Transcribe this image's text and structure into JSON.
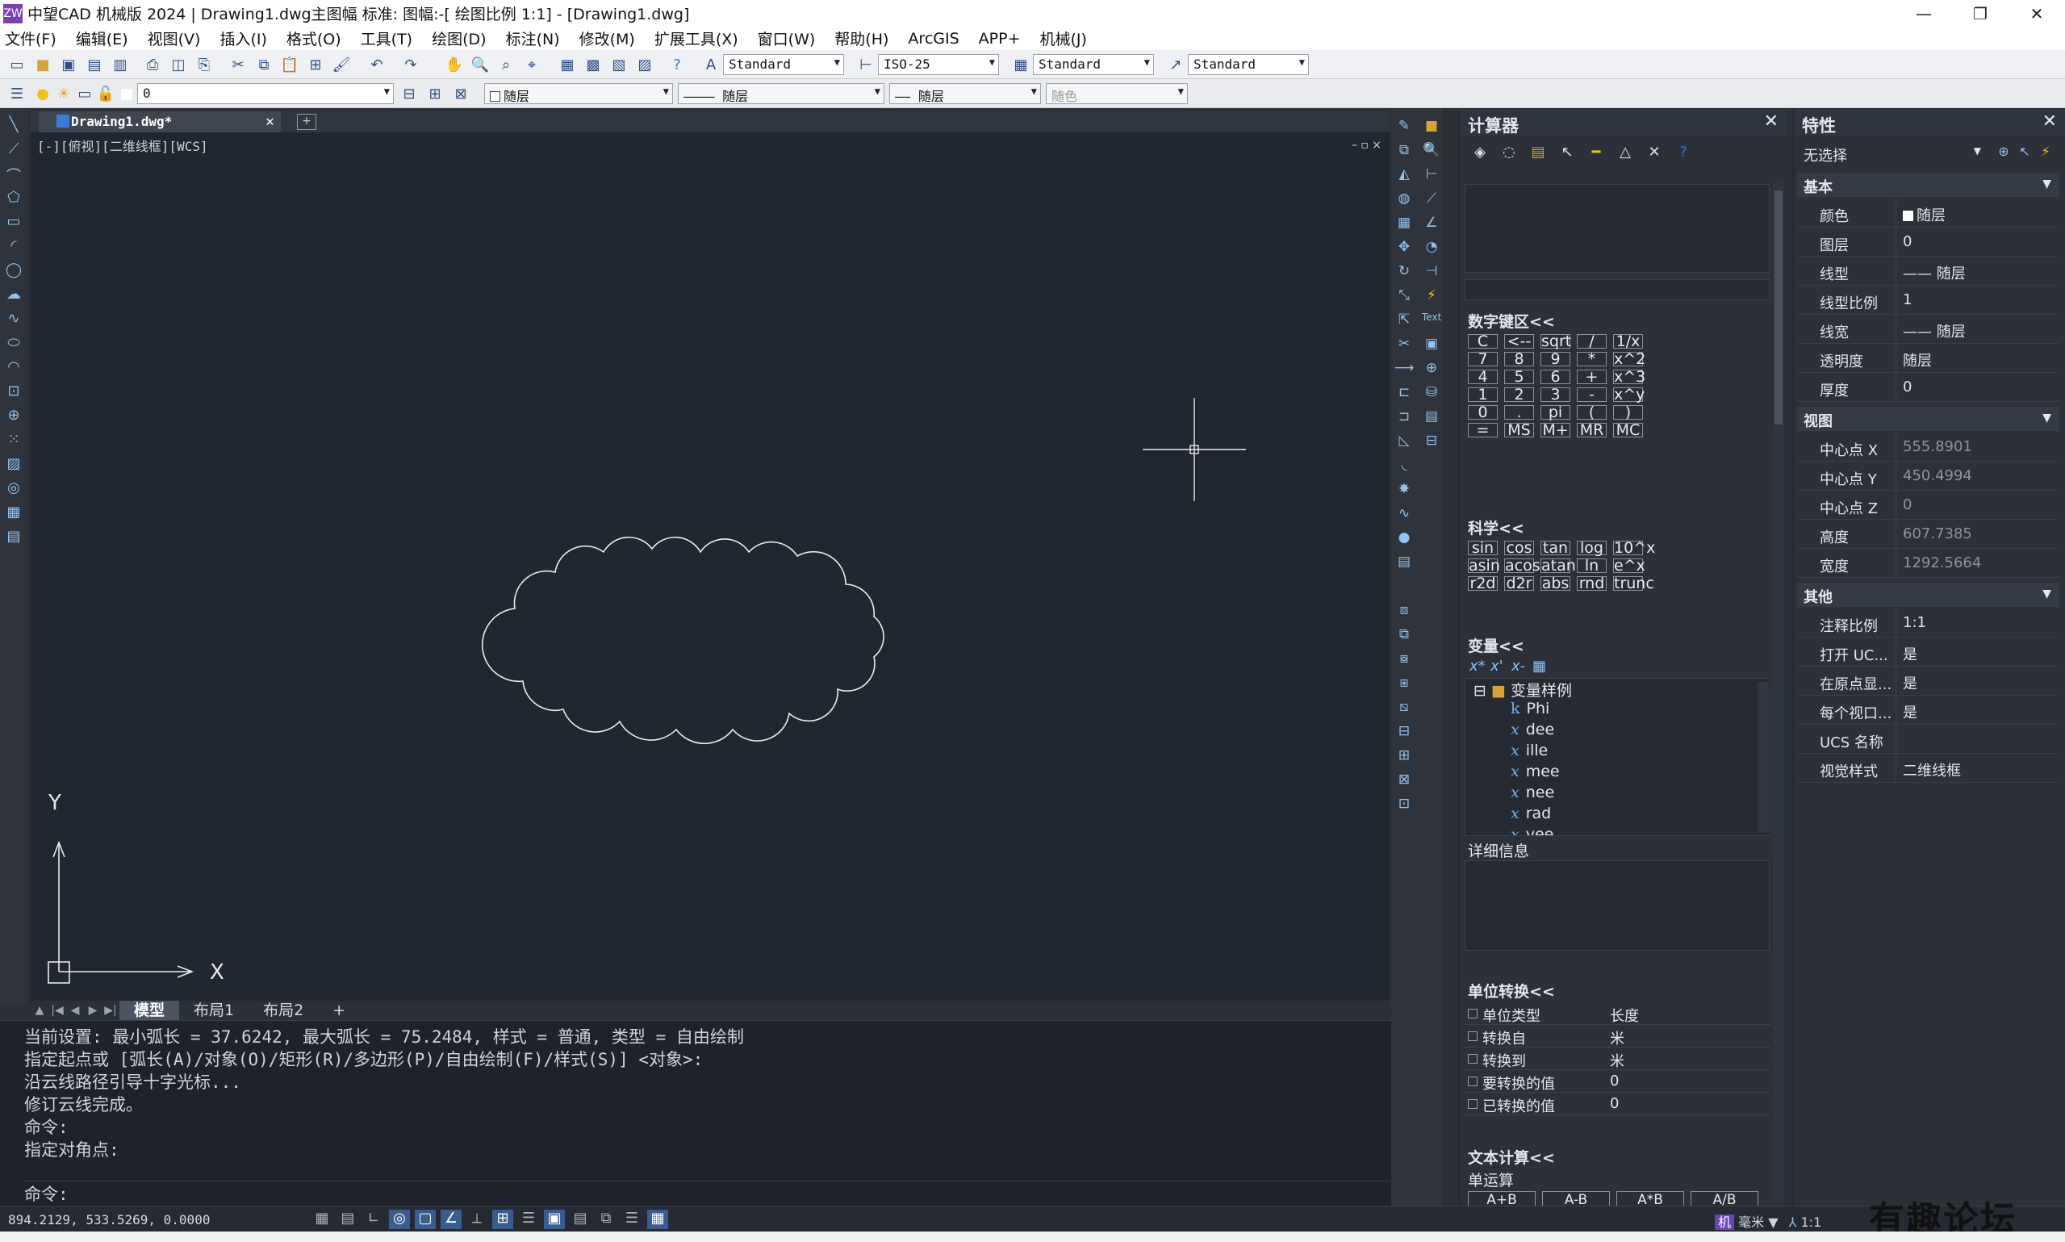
{
  "window": {
    "title": "中望CAD 机械版 2024 | Drawing1.dwg主图幅  标准: 图幅:-[ 绘图比例 1:1] - [Drawing1.dwg]",
    "app_icon": "ZW"
  },
  "menu": [
    "文件(F)",
    "编辑(E)",
    "视图(V)",
    "插入(I)",
    "格式(O)",
    "工具(T)",
    "绘图(D)",
    "标注(N)",
    "修改(M)",
    "扩展工具(X)",
    "窗口(W)",
    "帮助(H)",
    "ArcGIS",
    "APP+",
    "机械(J)"
  ],
  "toolbar": {
    "text_style": "Standard",
    "dim_style": "ISO-25",
    "table_style": "Standard",
    "mleader_style": "Standard",
    "layer": "0",
    "color": "随层",
    "linetype": "———— 随层",
    "lineweight": "—— 随层",
    "plot_style": "随色"
  },
  "doc_tab": {
    "name": "Drawing1.dwg*",
    "new_tab": "+"
  },
  "viewport": {
    "label": "[-][俯视][二维线框][WCS]",
    "controls": "– ▫ ×"
  },
  "ucs": {
    "x": "X",
    "y": "Y"
  },
  "layout_tabs": [
    "模型",
    "布局1",
    "布局2",
    "+"
  ],
  "command": {
    "history": [
      "当前设置: 最小弧长 = 37.6242, 最大弧长 = 75.2484, 样式 = 普通, 类型 = 自由绘制",
      "指定起点或 [弧长(A)/对象(O)/矩形(R)/多边形(P)/自由绘制(F)/样式(S)] <对象>:",
      "沿云线路径引导十字光标...",
      "修订云线完成。",
      "命令:",
      "指定对角点:"
    ],
    "prompt": "命令:"
  },
  "status": {
    "coords": "894.2129, 533.5269, 0.0000",
    "units": "毫米",
    "scale": "1:1",
    "watermark": "有趣论坛"
  },
  "calculator": {
    "title": "计算器",
    "numpad_label": "数字键区<<",
    "numpad_keys": [
      [
        "C",
        "<--",
        "sqrt",
        "/",
        "1/x"
      ],
      [
        "7",
        "8",
        "9",
        "*",
        "x^2"
      ],
      [
        "4",
        "5",
        "6",
        "+",
        "x^3"
      ],
      [
        "1",
        "2",
        "3",
        "-",
        "x^y"
      ],
      [
        "0",
        ".",
        "pi",
        "(",
        ")"
      ],
      [
        "=",
        "MS",
        "M+",
        "MR",
        "MC"
      ]
    ],
    "science_label": "科学<<",
    "science_keys": [
      [
        "sin",
        "cos",
        "tan",
        "log",
        "10^x"
      ],
      [
        "asin",
        "acos",
        "atan",
        "ln",
        "e^x"
      ],
      [
        "r2d",
        "d2r",
        "abs",
        "rnd",
        "trunc"
      ]
    ],
    "variables_label": "变量<<",
    "variable_folder": "变量样例",
    "variables": [
      {
        "type": "k",
        "name": "Phi"
      },
      {
        "type": "x",
        "name": "dee"
      },
      {
        "type": "x",
        "name": "ille"
      },
      {
        "type": "x",
        "name": "mee"
      },
      {
        "type": "x",
        "name": "nee"
      },
      {
        "type": "x",
        "name": "rad"
      },
      {
        "type": "x",
        "name": "vee"
      }
    ],
    "details_label": "详细信息",
    "unit_label": "单位转换<<",
    "unit_rows": [
      {
        "key": "单位类型",
        "value": "长度"
      },
      {
        "key": "转换自",
        "value": "米"
      },
      {
        "key": "转换到",
        "value": "米"
      },
      {
        "key": "要转换的值",
        "value": "0"
      },
      {
        "key": "已转换的值",
        "value": "0"
      }
    ],
    "text_calc_label": "文本计算<<",
    "unary_label": "单运算",
    "unary_ops": [
      "A+B",
      "A-B",
      "A*B",
      "A/B"
    ]
  },
  "properties": {
    "title": "特性",
    "selection": "无选择",
    "groups": [
      {
        "name": "基本",
        "rows": [
          {
            "key": "颜色",
            "value": "随层",
            "swatch": true
          },
          {
            "key": "图层",
            "value": "0"
          },
          {
            "key": "线型",
            "value": "—— 随层"
          },
          {
            "key": "线型比例",
            "value": "1"
          },
          {
            "key": "线宽",
            "value": "—— 随层"
          },
          {
            "key": "透明度",
            "value": "随层"
          },
          {
            "key": "厚度",
            "value": "0"
          }
        ]
      },
      {
        "name": "视图",
        "rows": [
          {
            "key": "中心点 X",
            "value": "555.8901",
            "grey": true
          },
          {
            "key": "中心点 Y",
            "value": "450.4994",
            "grey": true
          },
          {
            "key": "中心点 Z",
            "value": "0",
            "grey": true
          },
          {
            "key": "高度",
            "value": "607.7385",
            "grey": true
          },
          {
            "key": "宽度",
            "value": "1292.5664",
            "grey": true
          }
        ]
      },
      {
        "name": "其他",
        "rows": [
          {
            "key": "注释比例",
            "value": "1:1"
          },
          {
            "key": "打开 UC...",
            "value": "是"
          },
          {
            "key": "在原点显...",
            "value": "是"
          },
          {
            "key": "每个视口...",
            "value": "是"
          },
          {
            "key": "UCS 名称",
            "value": ""
          },
          {
            "key": "视觉样式",
            "value": "二维线框"
          }
        ]
      }
    ]
  }
}
